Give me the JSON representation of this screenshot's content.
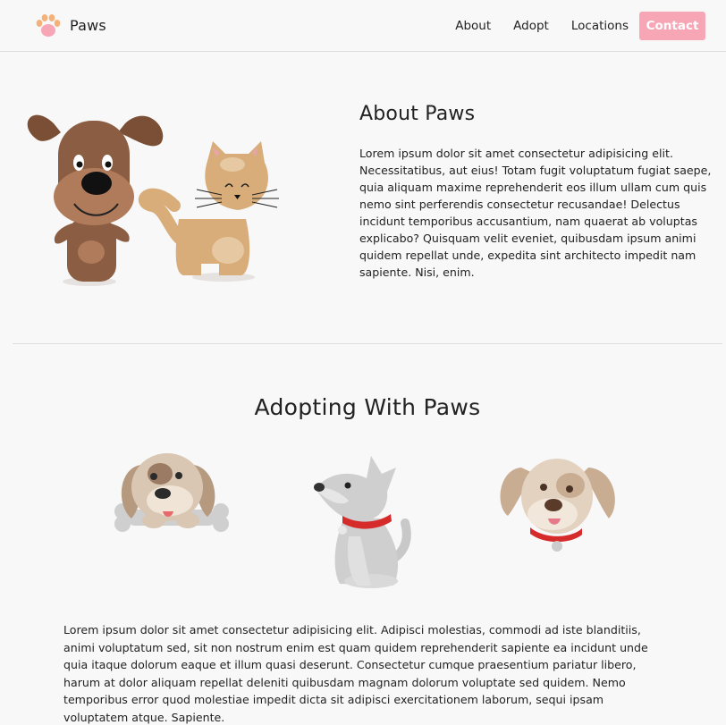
{
  "header": {
    "brand": "Paws",
    "nav": [
      "About",
      "Adopt",
      "Locations"
    ],
    "contact_label": "Contact"
  },
  "about": {
    "title": "About Paws",
    "text": "Lorem ipsum dolor sit amet consectetur adipisicing elit. Necessitatibus, aut eius! Totam fugit voluptatum fugiat saepe, quia aliquam maxime reprehenderit eos illum ullam cum quis nemo sint perferendis consectetur recusandae! Delectus incidunt temporibus accusantium, nam quaerat ab voluptas explicabo? Quisquam velit eveniet, quibusdam ipsum animi quidem repellat unde, expedita sint architecto impedit nam sapiente. Nisi, enim."
  },
  "adopt": {
    "title": "Adopting With Paws",
    "text": "Lorem ipsum dolor sit amet consectetur adipisicing elit. Adipisci molestias, commodi ad iste blanditiis, animi voluptatum sed, sit non nostrum enim est quam quidem reprehenderit sapiente ea incidunt unde quia itaque dolorum eaque et illum quasi deserunt. Consectetur cumque praesentium pariatur libero, harum at dolor aliquam repellat deleniti quibusdam magnam dolorum voluptate sed quidem. Nemo temporibus error quod molestiae impedit dicta sit adipisci exercitationem laborum, sequi ipsam voluptatem atque. Sapiente."
  },
  "icons": {
    "logo": "paw-icon",
    "about_illustration": "dog-and-cat-illustration",
    "pets": [
      "puppy-with-bone-illustration",
      "gray-sitting-dog-illustration",
      "puppy-head-illustration"
    ]
  },
  "colors": {
    "accent": "#f7a6b6",
    "paw_orange": "#f4b27a",
    "paw_pink": "#f7a6b6",
    "background": "#f8f8f9"
  }
}
